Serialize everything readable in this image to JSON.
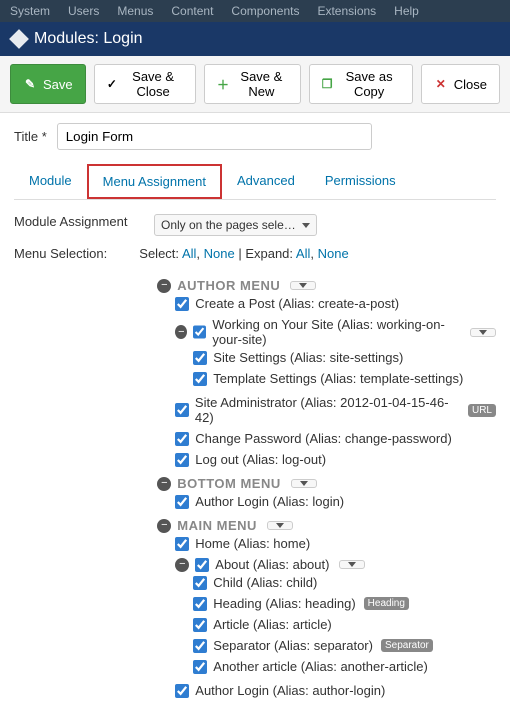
{
  "topmenu": [
    "System",
    "Users",
    "Menus",
    "Content",
    "Components",
    "Extensions",
    "Help"
  ],
  "header": {
    "title": "Modules: Login"
  },
  "toolbar": {
    "save": "Save",
    "saveClose": "Save & Close",
    "saveNew": "Save & New",
    "saveCopy": "Save as Copy",
    "close": "Close"
  },
  "title": {
    "label": "Title *",
    "value": "Login Form"
  },
  "tabs": {
    "module": "Module",
    "menuAssignment": "Menu Assignment",
    "advanced": "Advanced",
    "permissions": "Permissions"
  },
  "assignment": {
    "label": "Module Assignment",
    "value": "Only on the pages sele…"
  },
  "menuSelection": {
    "label": "Menu Selection:",
    "selectText": "Select:",
    "all": "All",
    "none": "None",
    "expandText": "Expand:"
  },
  "menus": [
    {
      "name": "AUTHOR MENU",
      "items": [
        {
          "label": "Create a Post",
          "alias": "create-a-post",
          "children": []
        },
        {
          "label": "Working on Your Site",
          "alias": "working-on-your-site",
          "expand": true,
          "children": [
            {
              "label": "Site Settings",
              "alias": "site-settings"
            },
            {
              "label": "Template Settings",
              "alias": "template-settings"
            }
          ]
        },
        {
          "label": "Site Administrator",
          "alias": "2012-01-04-15-46-42",
          "badge": "URL",
          "children": []
        },
        {
          "label": "Change Password",
          "alias": "change-password",
          "children": []
        },
        {
          "label": "Log out",
          "alias": "log-out",
          "children": []
        }
      ]
    },
    {
      "name": "BOTTOM MENU",
      "items": [
        {
          "label": "Author Login",
          "alias": "login",
          "children": []
        }
      ]
    },
    {
      "name": "MAIN MENU",
      "items": [
        {
          "label": "Home",
          "alias": "home",
          "children": []
        },
        {
          "label": "About",
          "alias": "about",
          "expand": true,
          "children": [
            {
              "label": "Child",
              "alias": "child"
            },
            {
              "label": "Heading",
              "alias": "heading",
              "badge": "Heading"
            },
            {
              "label": "Article",
              "alias": "article"
            },
            {
              "label": "Separator",
              "alias": "separator",
              "badge": "Separator"
            },
            {
              "label": "Another article",
              "alias": "another-article"
            }
          ]
        },
        {
          "label": "Author Login",
          "alias": "author-login",
          "children": []
        }
      ]
    }
  ]
}
